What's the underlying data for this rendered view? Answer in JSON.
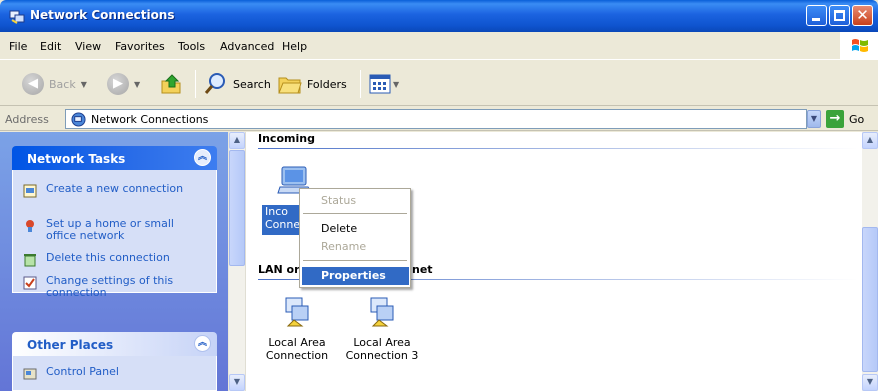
{
  "window": {
    "title": "Network Connections"
  },
  "menubar": {
    "items": [
      "File",
      "Edit",
      "View",
      "Favorites",
      "Tools",
      "Advanced",
      "Help"
    ]
  },
  "toolbar": {
    "back_label": "Back",
    "search_label": "Search",
    "folders_label": "Folders"
  },
  "address": {
    "label": "Address",
    "value": "Network Connections",
    "go_label": "Go"
  },
  "sidebar": {
    "network_tasks": {
      "title": "Network Tasks",
      "items": [
        {
          "label": "Create a new connection",
          "icon": "new-connection-icon"
        },
        {
          "label": "Set up a home or small office network",
          "icon": "home-network-icon"
        },
        {
          "label": "Delete this connection",
          "icon": "delete-icon"
        },
        {
          "label": "Change settings of this connection",
          "icon": "settings-icon"
        }
      ]
    },
    "other_places": {
      "title": "Other Places",
      "items": [
        {
          "label": "Control Panel",
          "icon": "control-panel-icon"
        }
      ]
    }
  },
  "content": {
    "groups": [
      {
        "title": "Incoming",
        "connections": [
          {
            "label_visible": "Inco\nConne",
            "icon": "incoming-connection-icon"
          }
        ]
      },
      {
        "title_left": "LAN or",
        "title_right": "net",
        "connections": [
          {
            "label": "Local Area\nConnection",
            "icon": "lan-connection-icon"
          },
          {
            "label": "Local Area\nConnection 3",
            "icon": "lan-connection-icon"
          }
        ]
      }
    ]
  },
  "context_menu": {
    "items": [
      {
        "label": "Status",
        "enabled": false
      },
      {
        "label": "Delete",
        "enabled": true
      },
      {
        "label": "Rename",
        "enabled": false
      },
      {
        "label": "Properties",
        "enabled": true,
        "highlighted": true
      }
    ]
  },
  "colors": {
    "titlebar": "#0A5FD8",
    "task_link": "#215DC6",
    "selection": "#316AC5",
    "pane_gradient_top": "#7BA2E7"
  }
}
